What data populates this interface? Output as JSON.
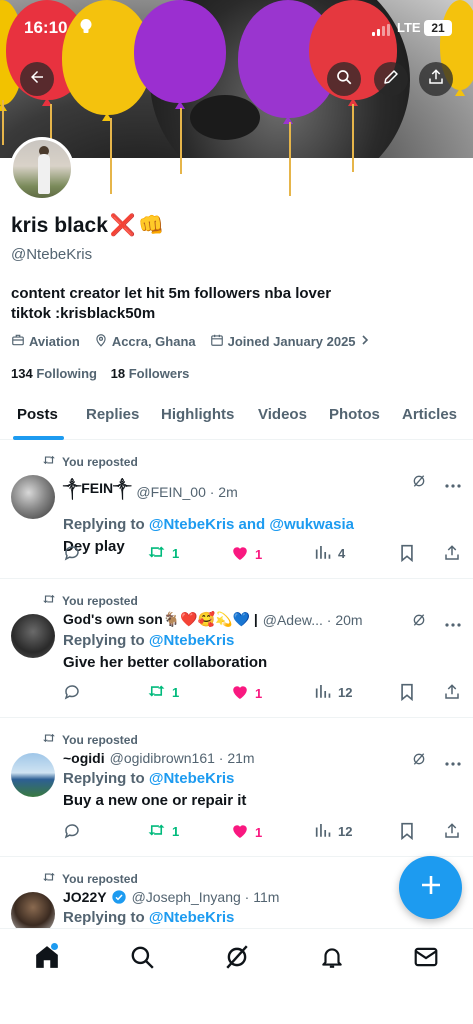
{
  "status_bar": {
    "time": "16:10",
    "network": "LTE",
    "battery": "21"
  },
  "profile": {
    "name": "kris black",
    "name_emojis": [
      "❌",
      "👊"
    ],
    "handle": "@NtebeKris",
    "bio_line1": "content creator let hit 5m followers nba lover",
    "bio_line2": "tiktok :krisblack50m",
    "category": "Aviation",
    "location": "Accra, Ghana",
    "joined": "Joined January 2025",
    "following_count": "134",
    "following_label": "Following",
    "followers_count": "18",
    "followers_label": "Followers"
  },
  "tabs": [
    {
      "label": "Posts",
      "active": true
    },
    {
      "label": "Replies",
      "active": false
    },
    {
      "label": "Highlights",
      "active": false
    },
    {
      "label": "Videos",
      "active": false
    },
    {
      "label": "Photos",
      "active": false
    },
    {
      "label": "Articles",
      "active": false
    }
  ],
  "posts": [
    {
      "reposted": "You reposted",
      "name": "༒FEIN༒",
      "handle": "@FEIN_00 · 2m",
      "replying_prefix": "Replying to",
      "replying_to": "@NtebeKris and @wukwasia",
      "text": "Dey play",
      "reposts": "1",
      "likes": "1",
      "views": "4"
    },
    {
      "reposted": "You reposted",
      "name": "God's own son🐐❤️🥰💫💙 |",
      "handle": "@Adew... · 20m",
      "replying_prefix": "Replying to",
      "replying_to": "@NtebeKris",
      "text": "Give her better collaboration",
      "reposts": "1",
      "likes": "1",
      "views": "12"
    },
    {
      "reposted": "You reposted",
      "name": "~ogidi",
      "handle": "@ogidibrown161 · 21m",
      "replying_prefix": "Replying to",
      "replying_to": "@NtebeKris",
      "text": "Buy a new one or repair it",
      "reposts": "1",
      "likes": "1",
      "views": "12"
    },
    {
      "reposted": "You reposted",
      "name": "JO22Y",
      "handle": "@Joseph_Inyang · 11m",
      "replying_prefix": "Replying to",
      "replying_to": "@NtebeKris"
    }
  ],
  "icons": {
    "back": "back-arrow-icon",
    "search": "search-icon",
    "edit": "pencil-icon",
    "share": "share-icon",
    "nav": [
      "home-icon",
      "search-icon",
      "grok-icon",
      "bell-icon",
      "mail-icon"
    ]
  },
  "colors": {
    "accent": "#1d9bf0",
    "repost_green": "#00ba7c",
    "like_pink": "#f91880",
    "muted": "#536471"
  }
}
